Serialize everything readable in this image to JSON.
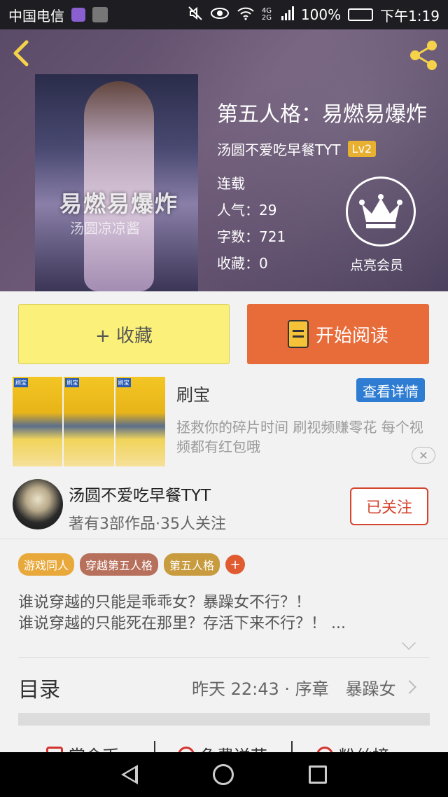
{
  "status_bar": {
    "carrier": "中国电信",
    "battery": "100%",
    "time": "下午1:19",
    "network": "4G 2G"
  },
  "book": {
    "title": "第五人格：易燃易爆炸",
    "author": "汤圆不爱吃早餐TYT",
    "level": "Lv2",
    "status": "连载",
    "popularity": "人气：29",
    "word_count": "字数：721",
    "favorites": "收藏：0",
    "cover_title": "易燃易爆炸",
    "cover_author": "汤圆凉凉酱"
  },
  "member": {
    "label": "点亮会员"
  },
  "actions": {
    "favorite_label": "+ 收藏",
    "read_label": "开始阅读"
  },
  "ad": {
    "name": "刷宝",
    "detail_label": "查看详情",
    "description": "拯救你的碎片时间 刷视频赚零花 每个视频都有红包哦",
    "thumb_tag": "刷宝",
    "close": "✕"
  },
  "author_card": {
    "name": "汤圆不爱吃早餐TYT",
    "stats": "著有3部作品·35人关注",
    "follow_label": "已关注"
  },
  "tags": [
    {
      "label": "游戏同人",
      "color": "#e8a93a"
    },
    {
      "label": "穿越第五人格",
      "color": "#b7705c"
    },
    {
      "label": "第五人格",
      "color": "#c79b3e"
    }
  ],
  "tag_add": "+",
  "description": {
    "line1": "谁说穿越的只能是乖乖女？暴躁女不行？！",
    "line2": "谁说穿越的只能死在那里？存活下来不行？！ ..."
  },
  "toc": {
    "label": "目录",
    "latest": "昨天 22:43 · 序章　暴躁女"
  },
  "bottom_tabs": [
    "赏金币",
    "免费送花",
    "粉丝榜"
  ],
  "colors": {
    "accent_yellow": "#fbf17a",
    "accent_orange": "#e86b3a",
    "accent_blue": "#2e7dd2",
    "follow_red": "#d4442e",
    "icon_yellow": "#f6d24a"
  }
}
